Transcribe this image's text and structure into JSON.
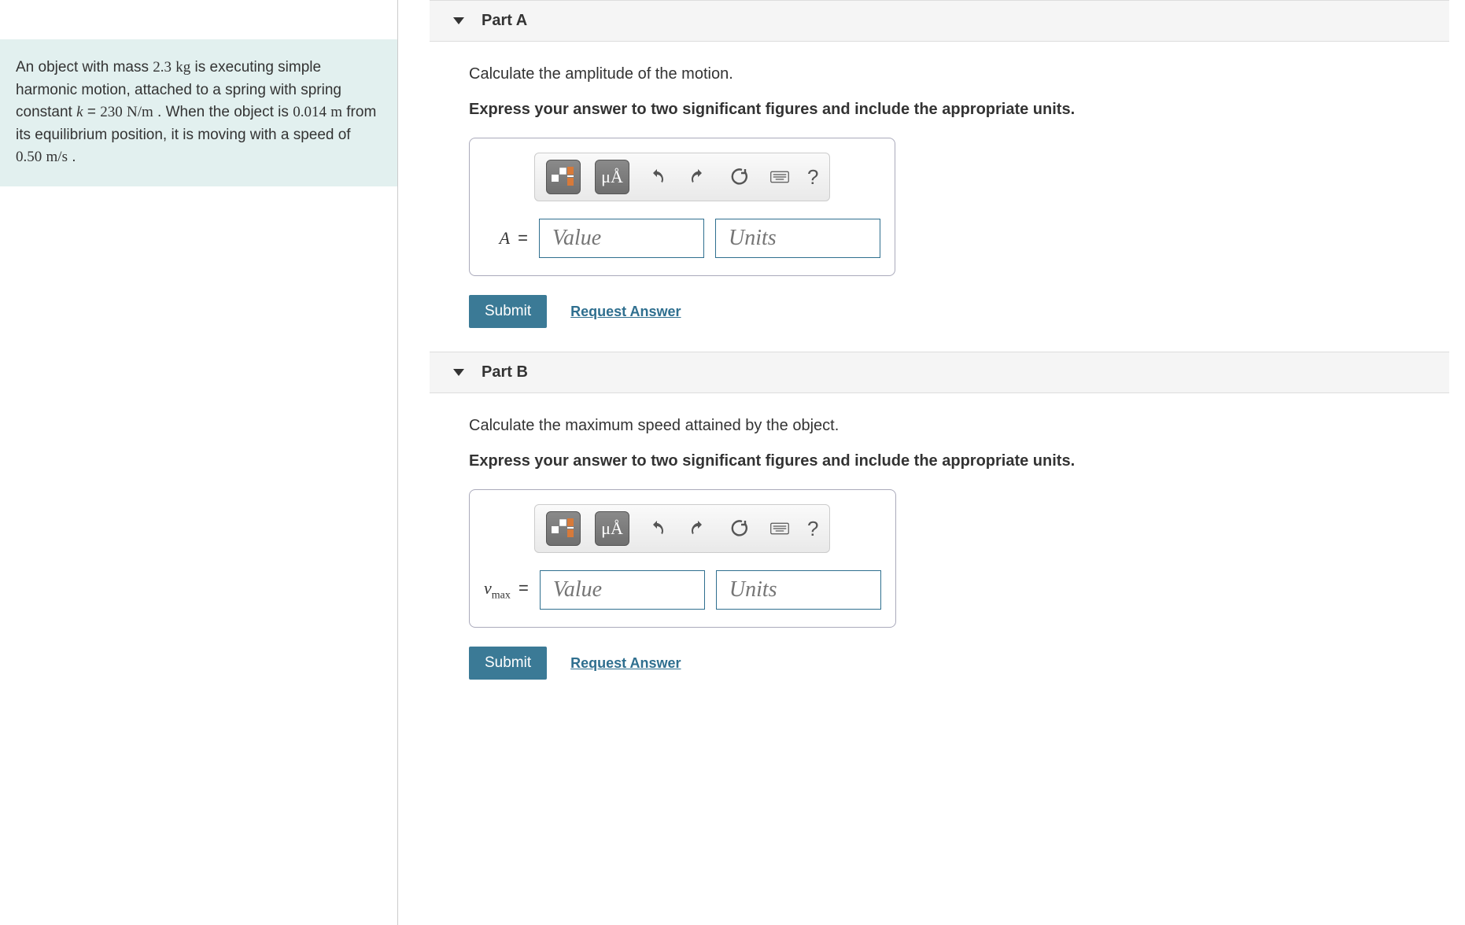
{
  "problem": {
    "text_prefix": "An object with mass ",
    "mass": "2.3",
    "mass_unit": "kg",
    "text_mid1": " is executing simple harmonic motion, attached to a spring with spring constant ",
    "k_sym": "k",
    "k_eq": " = ",
    "k_val": "230",
    "k_unit": "N/m",
    "text_mid2": " . When the object is ",
    "disp": "0.014",
    "disp_unit": "m",
    "text_mid3": " from its equilibrium position, it is moving with a speed of ",
    "speed": "0.50",
    "speed_unit": "m/s",
    "text_end": " ."
  },
  "partA": {
    "header": "Part A",
    "prompt": "Calculate the amplitude of the motion.",
    "instruction": "Express your answer to two significant figures and include the appropriate units.",
    "var_html": "A",
    "value_placeholder": "Value",
    "units_placeholder": "Units",
    "submit": "Submit",
    "request": "Request Answer"
  },
  "partB": {
    "header": "Part B",
    "prompt": "Calculate the maximum speed attained by the object.",
    "instruction": "Express your answer to two significant figures and include the appropriate units.",
    "var_html": "v",
    "var_sub": "max",
    "value_placeholder": "Value",
    "units_placeholder": "Units",
    "submit": "Submit",
    "request": "Request Answer"
  },
  "toolbar": {
    "mu_label": "μÅ",
    "help": "?"
  }
}
